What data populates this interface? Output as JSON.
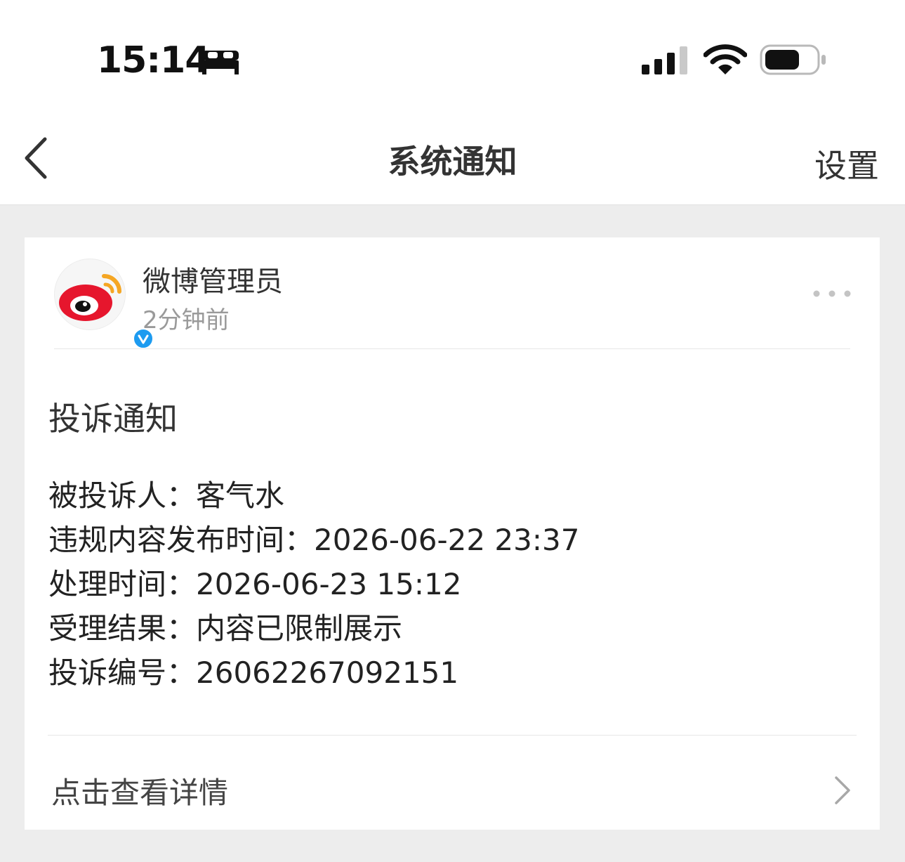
{
  "status_bar": {
    "time": "15:14",
    "sleep_icon": "bed-icon",
    "signal_icon": "cellular-signal-icon",
    "wifi_icon": "wifi-icon",
    "battery_icon": "battery-icon"
  },
  "nav": {
    "back_icon": "chevron-left-icon",
    "title": "系统通知",
    "settings_label": "设置"
  },
  "message": {
    "sender": "微博管理员",
    "time_ago": "2分钟前",
    "avatar_icon": "weibo-logo-icon",
    "verified_icon": "verified-badge-icon",
    "more_icon": "more-dots-icon",
    "title": "投诉通知",
    "details": [
      "被投诉人：客气水",
      "违规内容发布时间：2026-06-22 23:37",
      "处理时间：2026-06-23 15:12",
      "受理结果：内容已限制展示",
      "投诉编号：26062267092151"
    ],
    "action_label": "点击查看详情",
    "action_icon": "chevron-right-icon"
  },
  "colors": {
    "page_background": "#ededed",
    "card_background": "#ffffff",
    "text_primary": "#333333",
    "text_secondary": "#9a9a9a",
    "weibo_red": "#e6162d",
    "weibo_orange": "#f5a623",
    "verified_blue": "#1d9bf0"
  }
}
